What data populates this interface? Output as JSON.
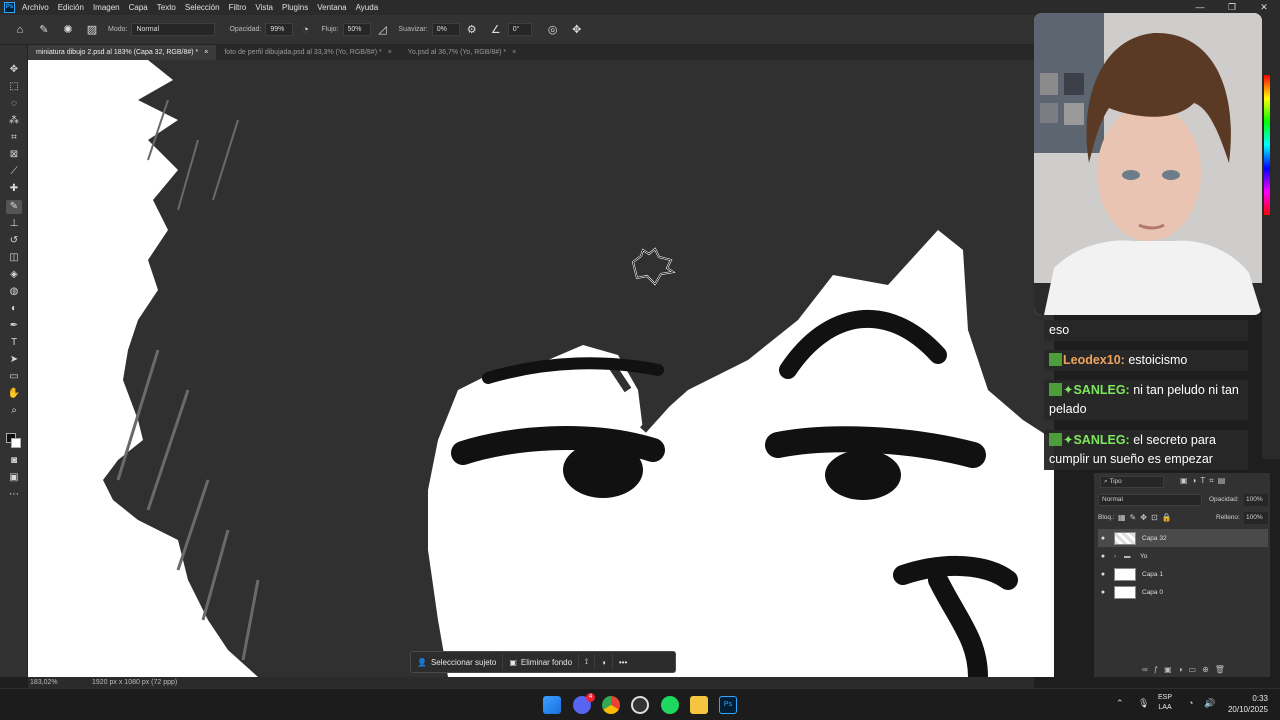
{
  "menubar": {
    "app_icon": "photoshop-icon",
    "items": [
      "Archivo",
      "Edición",
      "Imagen",
      "Capa",
      "Texto",
      "Selección",
      "Filtro",
      "Vista",
      "Plugins",
      "Ventana",
      "Ayuda"
    ]
  },
  "options": {
    "mode_label": "Modo:",
    "mode_value": "Normal",
    "opacity_label": "Opacidad:",
    "opacity_value": "99%",
    "flow_label": "Flujo:",
    "flow_value": "50%",
    "smoothing_label": "Suavizar:",
    "smoothing_value": "0%",
    "angle_value": "0°"
  },
  "tabs": [
    {
      "label": "miniatura dibujo 2.psd al 183% (Capa 32, RGB/8#) *",
      "close": "×"
    },
    {
      "label": "foto de perfil dibujada.psd al 33,3% (Yo, RGB/8#) *",
      "close": "×"
    },
    {
      "label": "Yo.psd al 36,7% (Yo, RGB/8#) *",
      "close": "×"
    }
  ],
  "status": {
    "zoom": "183,02%",
    "doc_size": "1920 px x 1080 px (72 ppp)"
  },
  "contextbar": {
    "select_subject": "Seleccionar sujeto",
    "remove_bg": "Eliminar fondo"
  },
  "chat": [
    {
      "user": "",
      "text": "eso",
      "user_color": "#ffffff"
    },
    {
      "user": "Leodex10:",
      "text": " estoicismo",
      "user_color": "#f0a35e"
    },
    {
      "user": "✦SANLEG:",
      "text": " ni tan peludo ni tan pelado",
      "user_color": "#7ee85c"
    },
    {
      "user": "✦SANLEG:",
      "text": " el secreto para cumplir un sueño es empezar",
      "user_color": "#7ee85c"
    }
  ],
  "layers": {
    "filter_label": "Tipo",
    "blend_mode": "Normal",
    "opacity_label": "Opacidad:",
    "opacity_value": "100%",
    "lock_label": "Bloq.:",
    "fill_label": "Relleno:",
    "fill_value": "100%",
    "items": [
      {
        "name": "Capa 32",
        "selected": true
      },
      {
        "name": "Yo",
        "folder": true
      },
      {
        "name": "Capa 1"
      },
      {
        "name": "Capa 0"
      }
    ]
  },
  "taskbar": {
    "lang_top": "ESP",
    "lang_bottom": "LAA",
    "time": "0:33",
    "date": "20/10/2025",
    "discord_badge": "4"
  },
  "colors": {
    "accent": "#31a8ff",
    "canvas_dark": "#303030",
    "chat_green": "#7ee85c",
    "chat_orange": "#f0a35e"
  }
}
